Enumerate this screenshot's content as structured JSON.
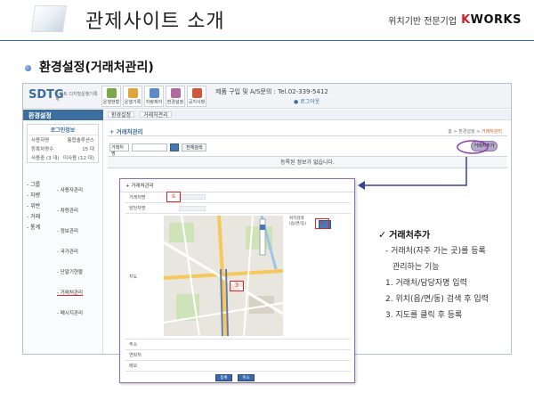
{
  "slide": {
    "title": "관제사이트 소개",
    "company_text": "위치기반 전문기업",
    "company_logo": "KWORKS",
    "section_title": "환경설정(거래처관리)"
  },
  "app": {
    "logo": "DTG",
    "logo_sub": "스마트 디지털운행기록계",
    "icons": [
      {
        "label": "운행현황",
        "color": "#7aa84a"
      },
      {
        "label": "운행기록",
        "color": "#e0a43a"
      },
      {
        "label": "차량제어",
        "color": "#5b8bc9"
      },
      {
        "label": "환경설정",
        "color": "#b06aa0"
      },
      {
        "label": "공지사항",
        "color": "#d0563d"
      }
    ],
    "contact": "제품 구입 및 A/S문의 : Tel.02-339-5412",
    "radio_text": "로그아웃",
    "left_header": "환경설정",
    "login": {
      "title": "로그인정보",
      "rows": [
        {
          "k": "사용자명",
          "v": "통합솔루션스"
        },
        {
          "k": "등록차량수",
          "v": "15 대"
        },
        {
          "k": "사용중 (3 대)",
          "v": "미사용 (12 대)"
        }
      ]
    },
    "menu": [
      "그룹",
      "차량",
      "위반",
      "거래",
      "통계"
    ],
    "submenu": [
      "사용자관리",
      "차량관리",
      "정보관리",
      "국가관리",
      "단말기현황",
      "거래처관리",
      "메시지관리"
    ],
    "tabs": [
      "환경설정",
      "거래처관리"
    ],
    "page_sub": "거래처관리",
    "breadcrumb": "홈 > 환경설정 >",
    "breadcrumb_current": "거래처관리",
    "search_select": "거래처명",
    "reset_label": "전체검색",
    "add_label": "거래처추가",
    "empty_text": "등록된 정보가 없습니다."
  },
  "popup": {
    "head": "거래처관리",
    "rows": [
      "거래처명",
      "담당자명",
      "지도",
      "주소",
      "연락처",
      "메모"
    ],
    "marks": [
      "①",
      "②",
      "③"
    ],
    "map_side": [
      "위치검색",
      "(읍/면/동)"
    ],
    "save": "등록",
    "cancel": "취소"
  },
  "description": {
    "title": "거래처추가",
    "lines": [
      "- 거래처(자주 가는 곳)를 등록",
      "관리하는 기능",
      "1. 거래처/담당자명 입력",
      "2. 위치(읍/면/동) 검색 후 입력",
      "3. 지도를 클릭 후 등록"
    ]
  }
}
